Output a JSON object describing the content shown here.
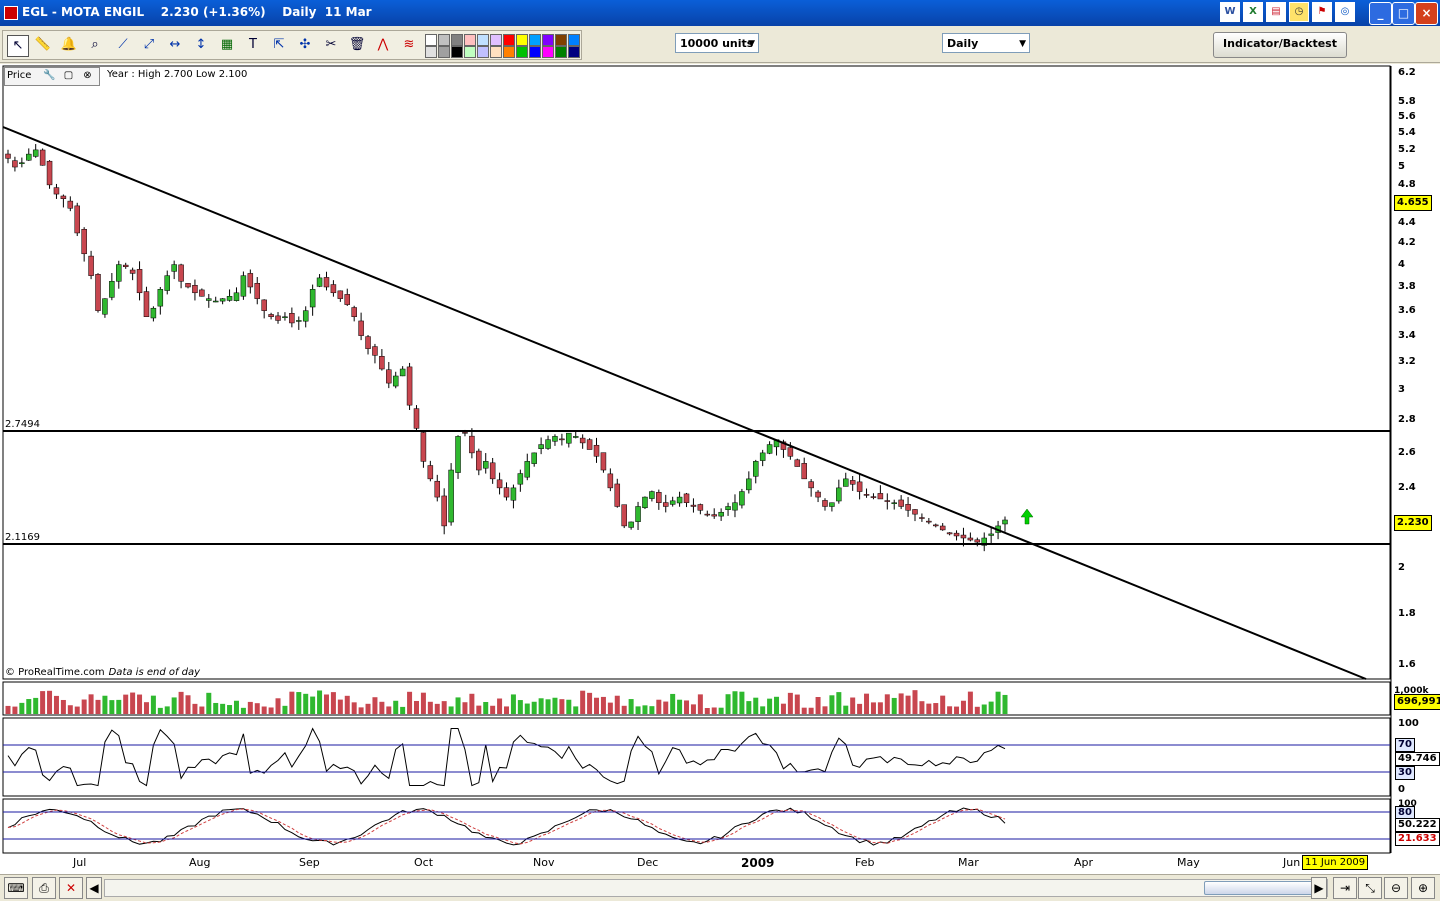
{
  "window": {
    "title": "EGL - MOTA ENGIL    2.230 (+1.36%)    Daily  11 Mar",
    "app_icons": [
      "word-icon",
      "excel-icon",
      "chart-icon",
      "clock-icon",
      "flag-icon",
      "globe-icon"
    ],
    "controls": {
      "minimize": "_",
      "maximize": "□",
      "close": "×"
    }
  },
  "toolbar": {
    "units_select": "10000 units",
    "period_select": "Daily",
    "indicator_button": "Indicator/Backtest",
    "tool_icons": [
      "pointer-icon",
      "ruler-icon",
      "alarm-icon",
      "zoom-icon",
      "line-icon",
      "ray-icon",
      "horizontal-line-icon",
      "vertical-line-icon",
      "channel-icon",
      "text-icon",
      "arrow-icon",
      "gann-icon",
      "trash-icon",
      "zigzag-icon",
      "fibonacci-icon"
    ],
    "swatch_colors": [
      "#ffffff",
      "#e0e0e0",
      "#c0c0c0",
      "#a0a0a0",
      "#808080",
      "#000000",
      "#ffc0c0",
      "#c0ffc0",
      "#c0e0ff",
      "#c0c0ff",
      "#e0c0ff",
      "#ffe0c0",
      "#ff0000",
      "#ff8000",
      "#ffff00",
      "#00c000",
      "#00a0ff",
      "#0000ff",
      "#8000ff",
      "#ff00ff",
      "#804000",
      "#008000",
      "#0080ff",
      "#000080"
    ]
  },
  "price_panel": {
    "header_label": "Price",
    "range_text": "Year : High 2.700 Low 2.100",
    "level_upper": "2.7494",
    "level_lower": "2.1169",
    "credit": "© ProRealTime.com",
    "credit_note": "Data is end of day",
    "last_price": "2.230",
    "marker_price": "4.655",
    "y_ticks": [
      "6.2",
      "5.8",
      "5.6",
      "5.4",
      "5.2",
      "5",
      "4.8",
      "4.4",
      "4.2",
      "4",
      "3.8",
      "3.6",
      "3.4",
      "3.2",
      "3",
      "2.8",
      "2.6",
      "2.4",
      "2.2",
      "2",
      "1.8",
      "1.6"
    ]
  },
  "volume_panel": {
    "last_value": "696,991",
    "top_tick": "1,000k"
  },
  "rsi_panel": {
    "ticks": [
      "100",
      "0"
    ],
    "upper": "70",
    "lower": "30",
    "value": "49.746"
  },
  "stoch_panel": {
    "top_tick": "100",
    "upper": "80",
    "value1": "50.222",
    "value2": "21.633"
  },
  "x_axis": {
    "labels": [
      "Jul",
      "Aug",
      "Sep",
      "Oct",
      "Nov",
      "Dec",
      "2009",
      "Feb",
      "Mar",
      "Apr",
      "May",
      "Jun"
    ],
    "cursor_date": "11 Jun 2009"
  },
  "colors": {
    "up": "#2fb82f",
    "down": "#c8464f",
    "arrow": "#00d000",
    "price_tag": "#ffff00"
  },
  "chart_data": {
    "type": "candlestick",
    "title": "EGL - MOTA ENGIL",
    "y_scale": "log",
    "ylim": [
      1.55,
      6.3
    ],
    "horizontal_levels": [
      2.7494,
      2.1169
    ],
    "trendline": {
      "from": [
        "2008-06-16",
        5.5
      ],
      "to": [
        "2009-05-31",
        1.55
      ]
    },
    "series": [
      {
        "name": "close",
        "values": [
          5.1,
          5.0,
          5.05,
          5.15,
          5.2,
          5.02,
          4.8,
          4.7,
          4.65,
          4.55,
          4.3,
          4.1,
          3.9,
          3.6,
          3.7,
          3.85,
          4.0,
          3.98,
          3.92,
          3.75,
          3.55,
          3.62,
          3.78,
          3.9,
          4.0,
          3.85,
          3.8,
          3.75,
          3.72,
          3.7,
          3.68,
          3.7,
          3.72,
          3.75,
          3.9,
          3.8,
          3.7,
          3.6,
          3.55,
          3.52,
          3.55,
          3.5,
          3.52,
          3.6,
          3.78,
          3.88,
          3.8,
          3.75,
          3.7,
          3.65,
          3.55,
          3.4,
          3.3,
          3.25,
          3.15,
          3.05,
          3.1,
          3.15,
          2.9,
          2.75,
          2.55,
          2.45,
          2.35,
          2.2,
          2.5,
          2.7,
          2.72,
          2.6,
          2.5,
          2.55,
          2.45,
          2.4,
          2.35,
          2.4,
          2.48,
          2.55,
          2.6,
          2.65,
          2.68,
          2.7,
          2.68,
          2.72,
          2.7,
          2.66,
          2.62,
          2.58,
          2.5,
          2.4,
          2.3,
          2.2,
          2.22,
          2.3,
          2.35,
          2.38,
          2.32,
          2.3,
          2.33,
          2.35,
          2.32,
          2.3,
          2.28,
          2.26,
          2.25,
          2.27,
          2.3,
          2.32,
          2.38,
          2.45,
          2.55,
          2.6,
          2.65,
          2.68,
          2.62,
          2.58,
          2.52,
          2.45,
          2.4,
          2.35,
          2.3,
          2.32,
          2.4,
          2.45,
          2.42,
          2.38,
          2.36,
          2.35,
          2.34,
          2.33,
          2.32,
          2.3,
          2.28,
          2.26,
          2.24,
          2.22,
          2.2,
          2.18,
          2.16,
          2.15,
          2.14,
          2.13,
          2.12,
          2.14,
          2.16,
          2.2,
          2.23
        ]
      }
    ],
    "volume": {
      "unit": "shares",
      "last": 696991
    },
    "rsi": {
      "last": 49.746,
      "bands": [
        30,
        70
      ]
    },
    "stochastic": {
      "k": 50.222,
      "d": 21.633,
      "bands": [
        20,
        80
      ]
    }
  }
}
